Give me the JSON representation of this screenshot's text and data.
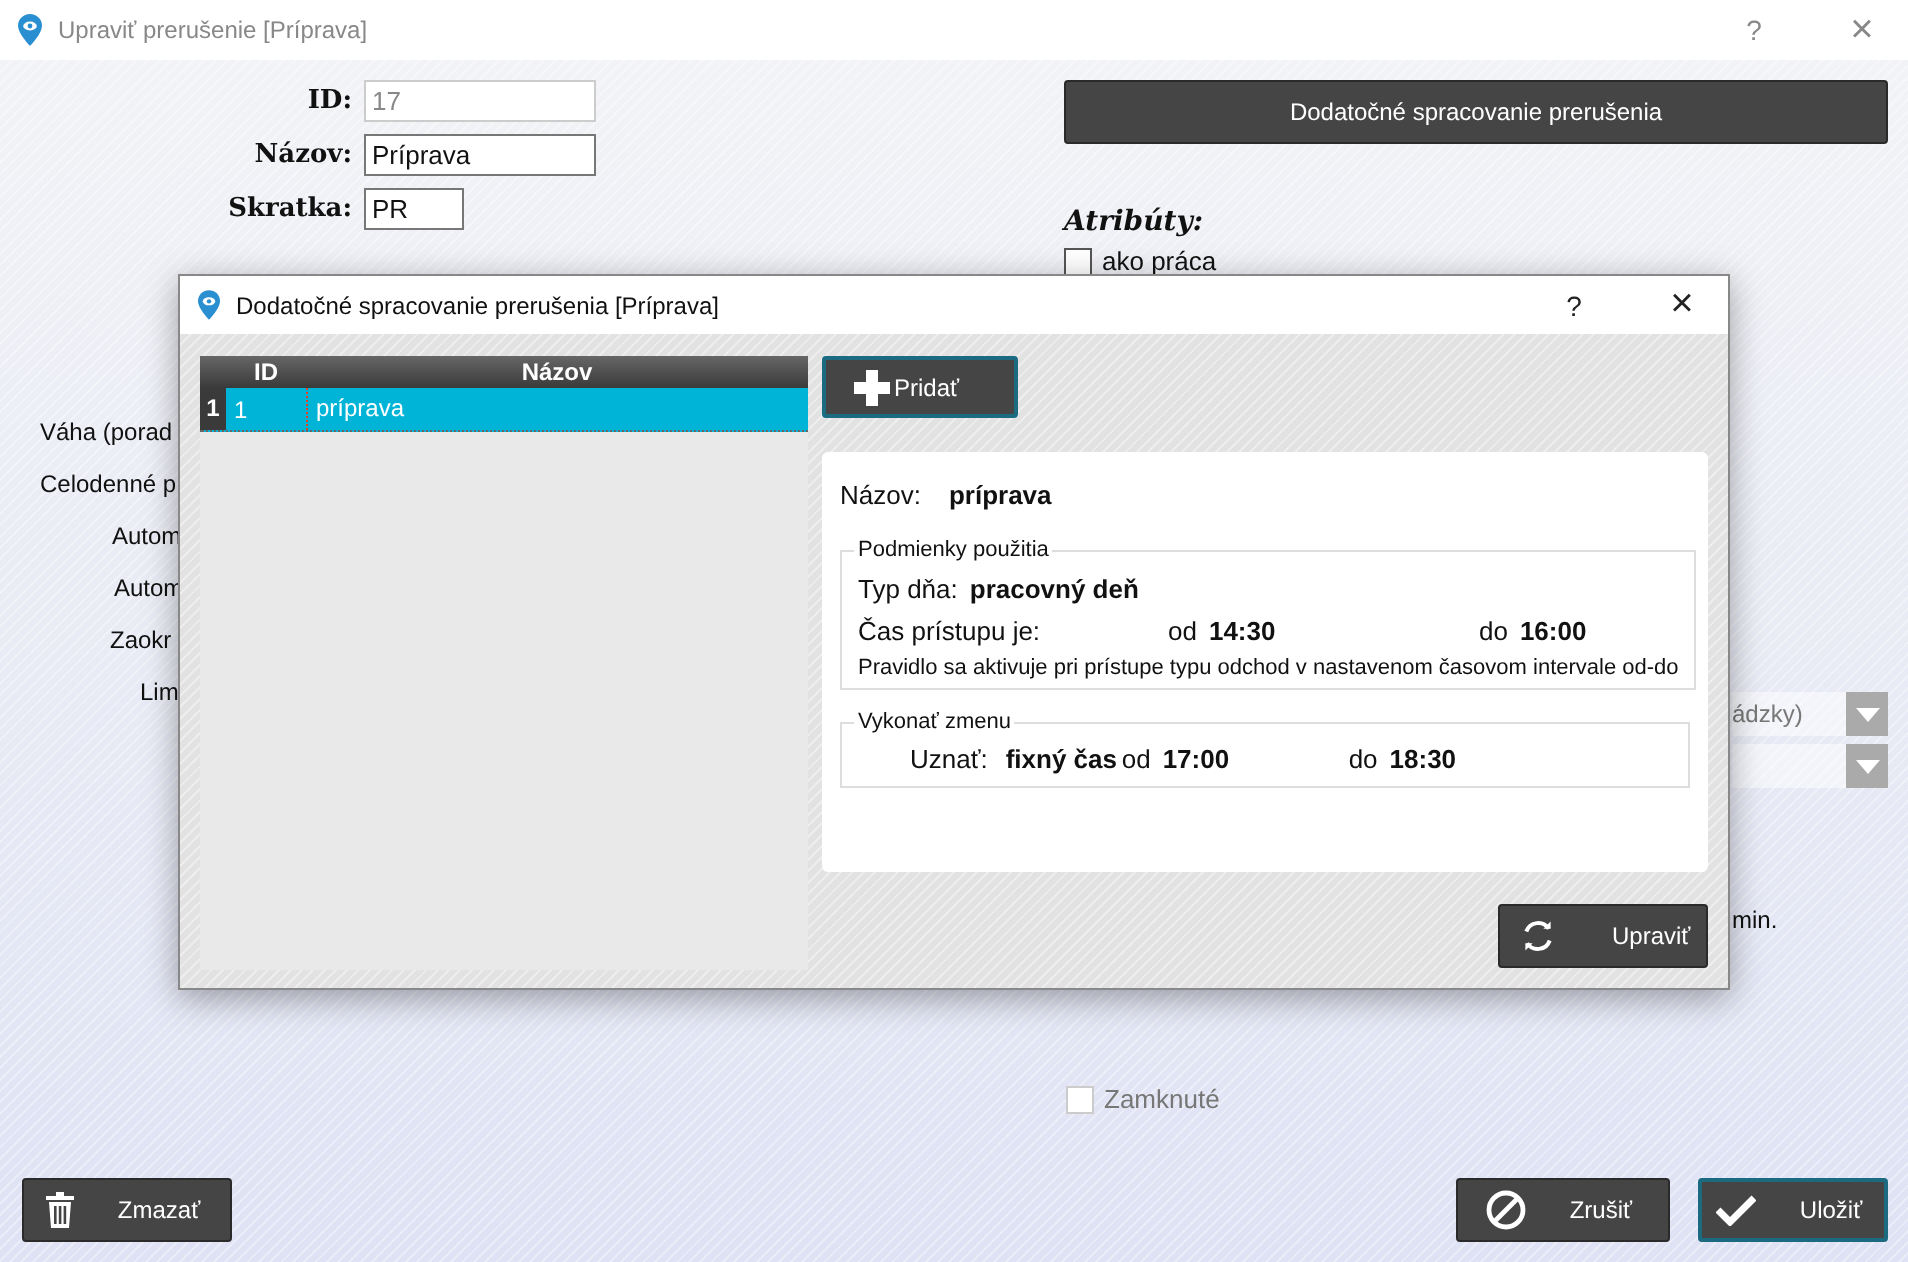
{
  "window": {
    "title": "Upraviť prerušenie [Príprava]",
    "help": "?",
    "close": "×"
  },
  "form": {
    "fields": [
      {
        "label": "ID:",
        "value": "17",
        "disabled": true
      },
      {
        "label": "Názov:",
        "value": "Príprava",
        "disabled": false
      },
      {
        "label": "Skratka:",
        "value": "PR",
        "disabled": false
      }
    ],
    "post_processing_button": "Dodatočné spracovanie prerušenia",
    "attributes_heading": "Atribúty:",
    "attributes": [
      {
        "label": "ako práca",
        "checked": false
      }
    ],
    "left_labels": [
      "Váha (porad",
      "Celodenné p",
      "Autom",
      "Autom",
      "Zaokr",
      "Lim"
    ],
    "dropdowns": [
      {
        "kind": "text",
        "value": "ádzky)"
      },
      {
        "kind": "blank"
      }
    ],
    "unit_text": "min.",
    "locked": {
      "label": "Zamknuté",
      "checked": false,
      "disabled": true
    }
  },
  "buttons": [
    {
      "kind": "delete",
      "label": "Zmazať"
    },
    {
      "kind": "cancel",
      "label": "Zrušiť"
    },
    {
      "kind": "save",
      "label": "Uložiť"
    }
  ],
  "dialog": {
    "title": "Dodatočné spracovanie prerušenia [Príprava]",
    "help": "?",
    "close": "×",
    "grid": {
      "columns": [
        "ID",
        "Názov"
      ],
      "rows": [
        {
          "number": "1",
          "id": "1",
          "name": "príprava",
          "selected": true
        }
      ]
    },
    "add_button": "Pridať",
    "detail": {
      "name_label": "Názov:",
      "name": "príprava",
      "conditions": {
        "legend": "Podmienky použitia",
        "day_type_label": "Typ dňa:",
        "day_type": "pracovný deň",
        "access_label": "Čas prístupu je:",
        "from_label": "od",
        "from": "14:30",
        "to_label": "do",
        "to": "16:00",
        "note": "Pravidlo sa aktivuje pri prístupe typu odchod v nastavenom časovom intervale od-do"
      },
      "action": {
        "legend": "Vykonať zmenu",
        "label": "Uznať:",
        "value": "fixný čas",
        "from_label": "od",
        "from": "17:00",
        "to_label": "do",
        "to": "18:30"
      }
    },
    "edit_button": "Upraviť"
  }
}
